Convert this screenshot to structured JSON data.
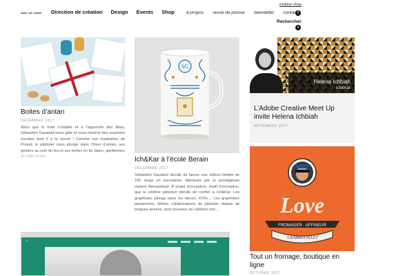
{
  "header": {
    "main_nav": [
      "Direction de création",
      "Design",
      "Events",
      "Shop"
    ],
    "secondary_nav": [
      "à propos",
      "revue de presse",
      "newsletter",
      "contact"
    ],
    "shop_link": "ich&kar shop",
    "search_label": "Rechercher",
    "social": [
      {
        "icon": "facebook-icon",
        "glyph": "f"
      },
      {
        "icon": "twitter-icon",
        "glyph": "t"
      },
      {
        "icon": "instagram-icon",
        "glyph": "in"
      }
    ]
  },
  "posts": [
    {
      "title": "Boites d’antan",
      "date": "Décembre 2017",
      "excerpt": "Alors que le froid s’installe et à l’approche des fêtes, Sébastien Gaudard nous gâte et nous réserve des surprises sucrées dont il a le secret ! Comme une madeleine de Proust, le pâtissier nous plonge dans l’hiver d’antan, ses goûters au coin du feu et ses boîtes en fer blanc, gardiennes de mille et une…"
    },
    {
      "title": "Ich&Kar à l’école Berain",
      "date": "Décembre 2017",
      "excerpt": "Sébastien Gaudard décide de lancer une édition limitée de 150 mugs en porcelaine, fabriqués par la prestigieuse maison Bernardaud. À projet d’exception, motif d’exception, que le célèbre pâtissier décide de confier à Ich&Kar. Les graphistes plonge dans les décors XVIIe… Les graphistes passionnés, fidèles collaborateurs du pâtissier depuis de longues années, sont soucieux de célébrer son…"
    },
    {
      "title": "L’Adobe Creative Meet Up invite Helena Ichbiah",
      "date": "Novembre 2017",
      "image_caption_name": "Helena Ichbiah",
      "image_caption_brand": "Ich&Kar"
    },
    {
      "title": "Tout un fromage, boutique en ligne",
      "date": "Octobre 2017",
      "image_text": {
        "word": "Love",
        "banner": "FROMAGER · AFFINEUR",
        "ribbon": "À RAMBOUILLET"
      }
    }
  ],
  "colors": {
    "cheese_bg": "#ec6a2d",
    "site_green": "#1e8c70",
    "ribbon_red": "#c0202a"
  }
}
